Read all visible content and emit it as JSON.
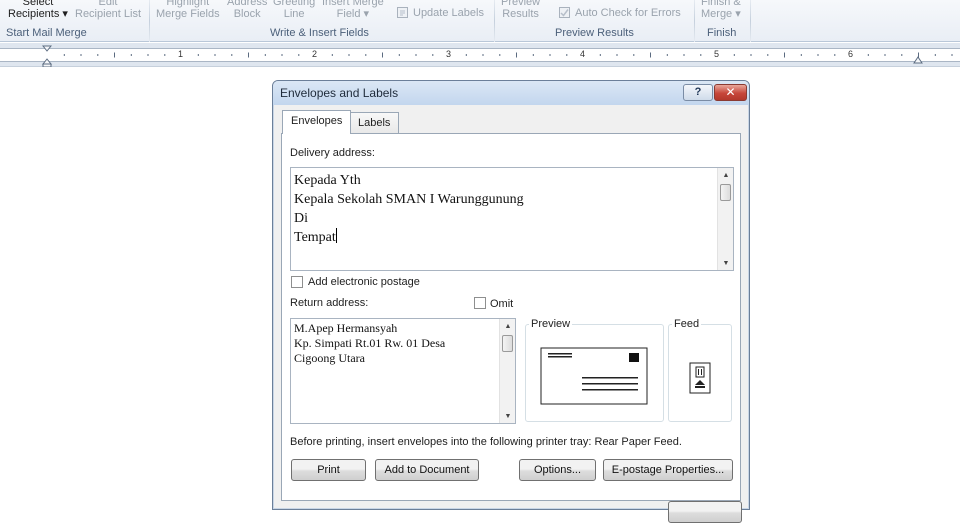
{
  "ribbon": {
    "buttons": [
      {
        "line1": "Select",
        "line2": "Recipients ▾",
        "dim": false
      },
      {
        "line1": "Edit",
        "line2": "Recipient List",
        "dim": true
      },
      {
        "line1": "Highlight",
        "line2": "Merge Fields",
        "dim": true
      },
      {
        "line1": "Address",
        "line2": "Block",
        "dim": true
      },
      {
        "line1": "Greeting",
        "line2": "Line",
        "dim": true
      },
      {
        "line1": "Insert Merge",
        "line2": "Field ▾",
        "dim": true
      },
      {
        "line1": "Preview",
        "line2": "Results",
        "dim": true
      },
      {
        "line1": "Finish &",
        "line2": "Merge ▾",
        "dim": true
      }
    ],
    "update_labels": "Update Labels",
    "auto_check": "Auto Check for Errors",
    "groups": [
      "Start Mail Merge",
      "Write & Insert Fields",
      "Preview Results",
      "Finish"
    ]
  },
  "ruler": {
    "numbers": [
      "1",
      "2",
      "3",
      "4",
      "5",
      "6"
    ]
  },
  "dialog": {
    "title": "Envelopes and Labels",
    "help": "?",
    "close": "✕",
    "tabs": {
      "envelopes": "Envelopes",
      "labels": "Labels"
    },
    "delivery_label": "Delivery address:",
    "delivery_lines": [
      "Kepada Yth",
      "Kepala Sekolah SMAN I Warunggunung",
      "Di",
      "Tempat"
    ],
    "add_postage": "Add electronic postage",
    "return_label": "Return address:",
    "omit": "Omit",
    "return_lines": [
      "M.Apep Hermansyah",
      "Kp. Simpati Rt.01 Rw. 01 Desa",
      "Cigoong Utara"
    ],
    "preview_label": "Preview",
    "feed_label": "Feed",
    "note": "Before printing, insert envelopes into the following printer tray: Rear Paper Feed.",
    "buttons": {
      "print": "Print",
      "add_to_document": "Add to Document",
      "options": "Options...",
      "epostage": "E-postage Properties..."
    }
  }
}
